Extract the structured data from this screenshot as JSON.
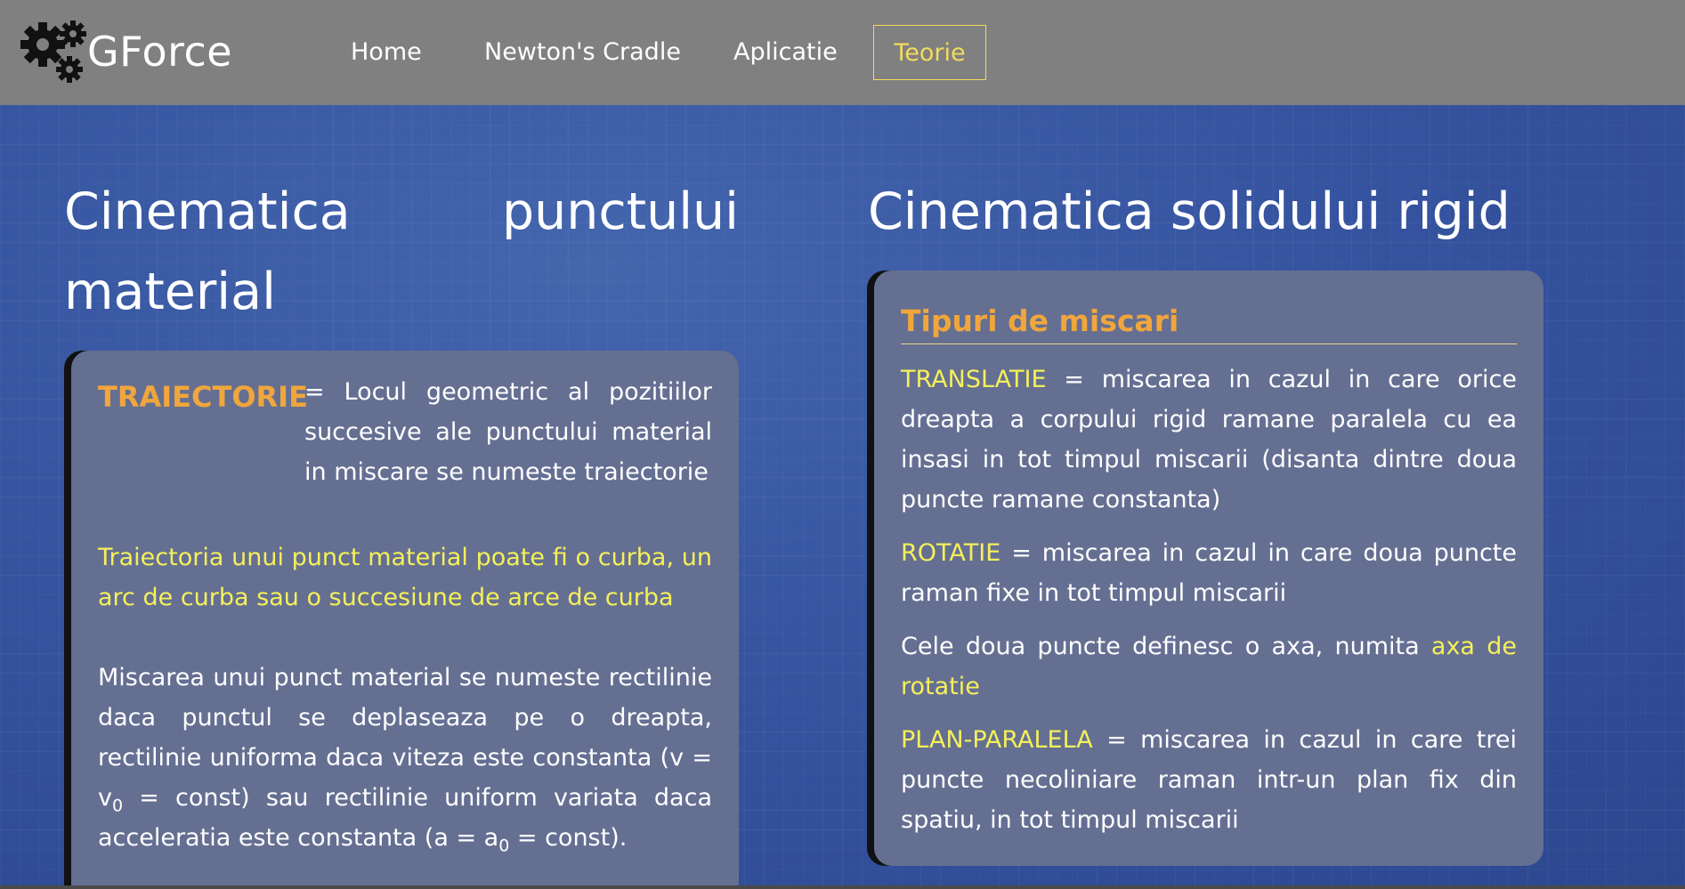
{
  "app": {
    "logo_text": "GForce",
    "logo_icon": "gears-icon"
  },
  "nav": {
    "items": [
      {
        "label": "Home",
        "active": false
      },
      {
        "label": "Newton's Cradle",
        "active": false
      },
      {
        "label": "Aplicatie",
        "active": false
      },
      {
        "label": "Teorie",
        "active": true
      }
    ]
  },
  "left": {
    "title_word1": "Cinematica",
    "title_word2": "punctului",
    "title_word3": "material",
    "term": "TRAIECTORIE",
    "definition": "= Locul geometric al pozitiilor succesive ale punctului material in miscare se numeste traiectorie",
    "note": "Traiectoria unui punct material poate fi o curba, un arc de curba sau o succesiune de arce de curba",
    "miscare_part1": "Miscarea unui punct material se numeste rectilinie daca punctul se deplaseaza pe o dreapta, rectilinie uniforma daca viteza este constanta (v = v",
    "miscare_sub1": "0",
    "miscare_part2": " = const) sau rectilinie uniform variata daca acceleratia este constanta (a = a",
    "miscare_sub2": "0",
    "miscare_part3": " = const)."
  },
  "right": {
    "title": "Cinematica solidului rigid",
    "card_heading": "Tipuri de miscari",
    "translatie_term": "TRANSLATIE",
    "translatie_text": " = miscarea in cazul in care orice dreapta a corpului rigid ramane paralela cu ea insasi in tot timpul miscarii (disanta dintre doua puncte ramane constanta)",
    "rotatie_term": "ROTATIE",
    "rotatie_text": " = miscarea in cazul in care doua puncte raman fixe in tot timpul miscarii",
    "axa_text": "Cele doua puncte definesc o axa, numita ",
    "axa_term": "axa de rotatie",
    "plan_term": "PLAN-PARALELA",
    "plan_text": " = miscarea in cazul in care trei puncte necoliniare raman intr-un plan fix din spatiu, in tot timpul miscarii"
  },
  "colors": {
    "navbar_bg": "#808080",
    "active_nav": "#f2dc5d",
    "highlight_yellow": "#f4f05a",
    "term_orange": "#f0a63c",
    "card_bg": "#656f92",
    "page_bg": "#34539e"
  }
}
